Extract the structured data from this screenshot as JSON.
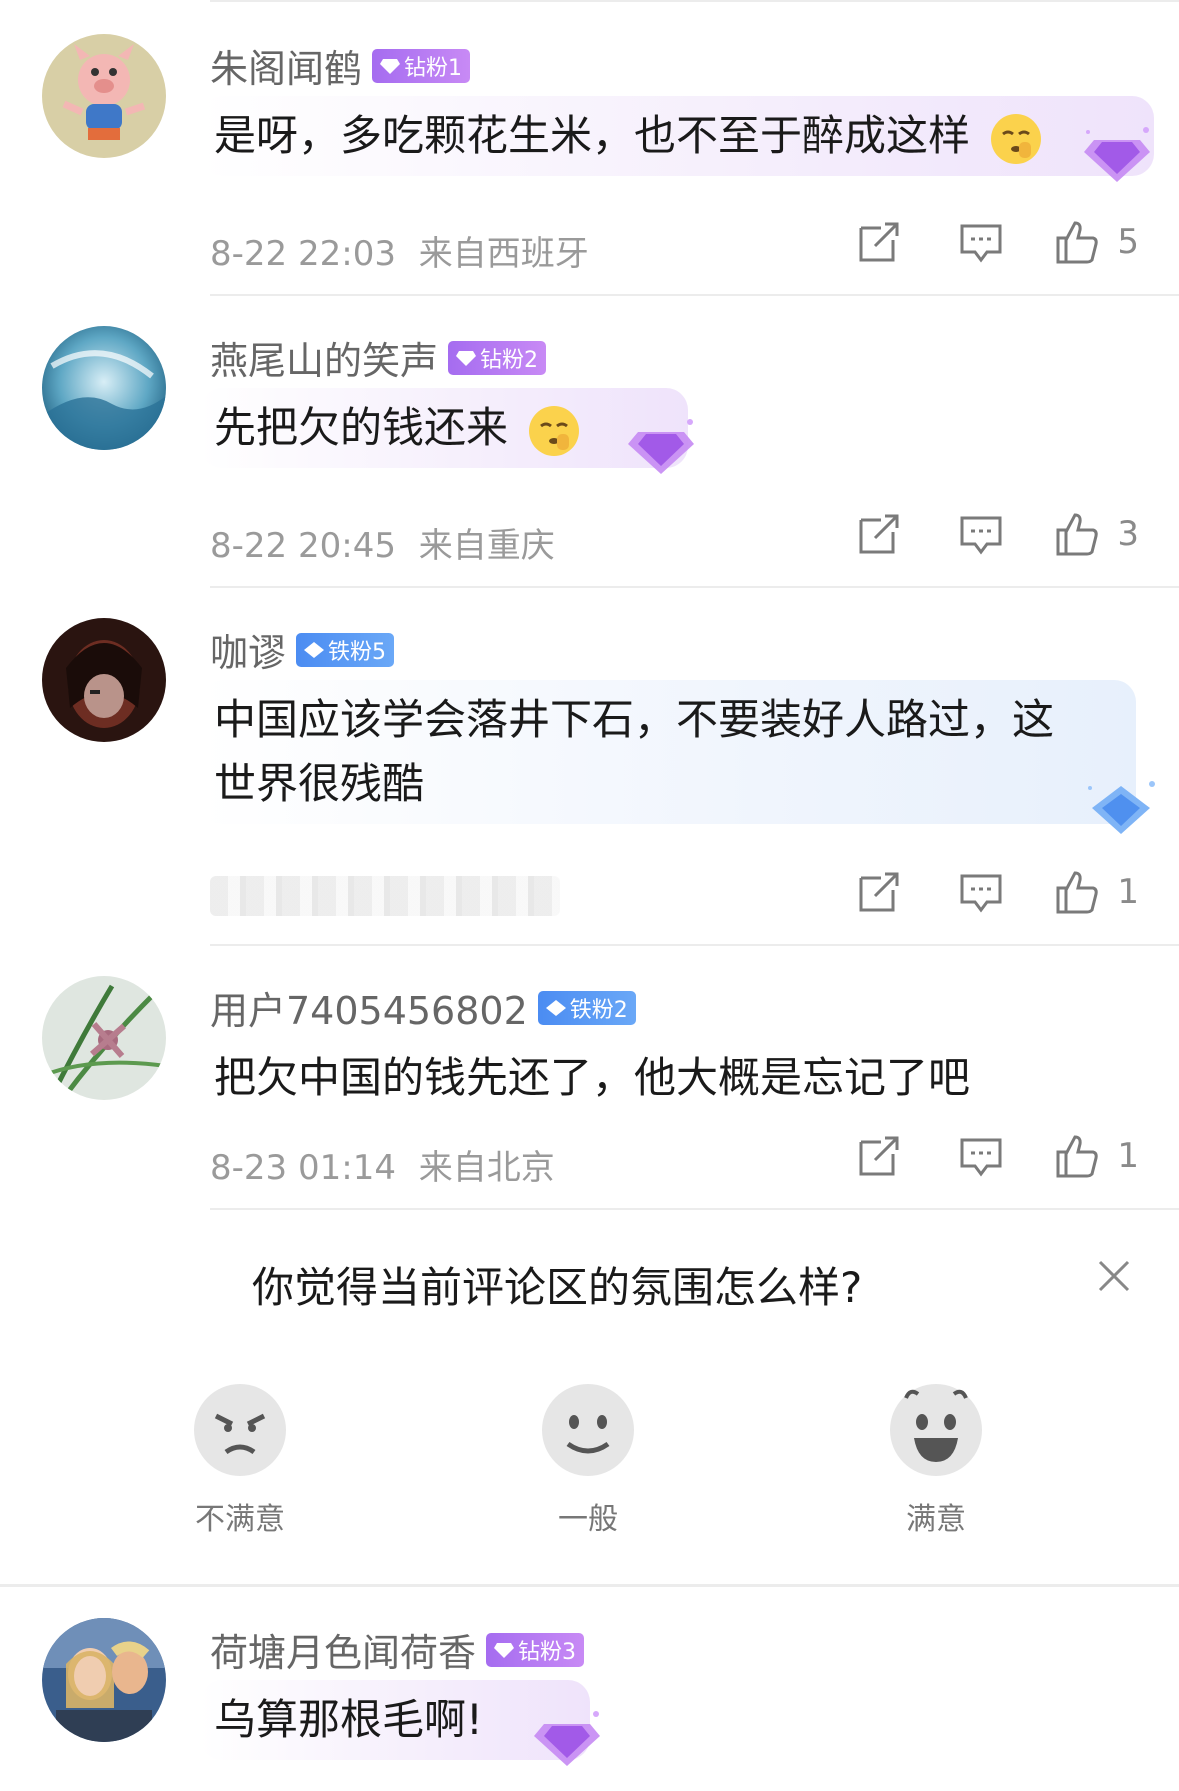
{
  "comments": [
    {
      "username": "朱阁闻鹤",
      "badge": "钻粉1",
      "badge_type": "diamond",
      "text": "是呀，多吃颗花生米，也不至于醉成这样",
      "emoji": "shushing-face",
      "time": "8-22 22:03",
      "location": "来自西班牙",
      "likes": "5"
    },
    {
      "username": "燕尾山的笑声",
      "badge": "钻粉2",
      "badge_type": "diamond",
      "text": "先把欠的钱还来",
      "emoji": "shushing-face",
      "time": "8-22 20:45",
      "location": "来自重庆",
      "likes": "3"
    },
    {
      "username": "咖谬",
      "badge": "铁粉5",
      "badge_type": "iron",
      "text_line1": "中国应该学会落井下石，不要装好人路过，这",
      "text_line2": "世界很残酷",
      "time": "",
      "location": "",
      "likes": "1"
    },
    {
      "username": "用户7405456802",
      "badge": "铁粉2",
      "badge_type": "iron",
      "text": "把欠中国的钱先还了，他大概是忘记了吧",
      "time": "8-23 01:14",
      "location": "来自北京",
      "likes": "1"
    },
    {
      "username": "荷塘月色闻荷香",
      "badge": "钻粉3",
      "badge_type": "diamond",
      "text": "乌算那根毛啊!"
    }
  ],
  "survey": {
    "question": "你觉得当前评论区的氛围怎么样?",
    "options": [
      {
        "label": "不满意",
        "icon": "angry-face-icon"
      },
      {
        "label": "一般",
        "icon": "neutral-face-icon"
      },
      {
        "label": "满意",
        "icon": "happy-face-icon"
      }
    ]
  },
  "colors": {
    "diamond_badge": "#a56cf0",
    "iron_badge": "#4b8cf2",
    "meta_text": "#9a9a9a"
  }
}
